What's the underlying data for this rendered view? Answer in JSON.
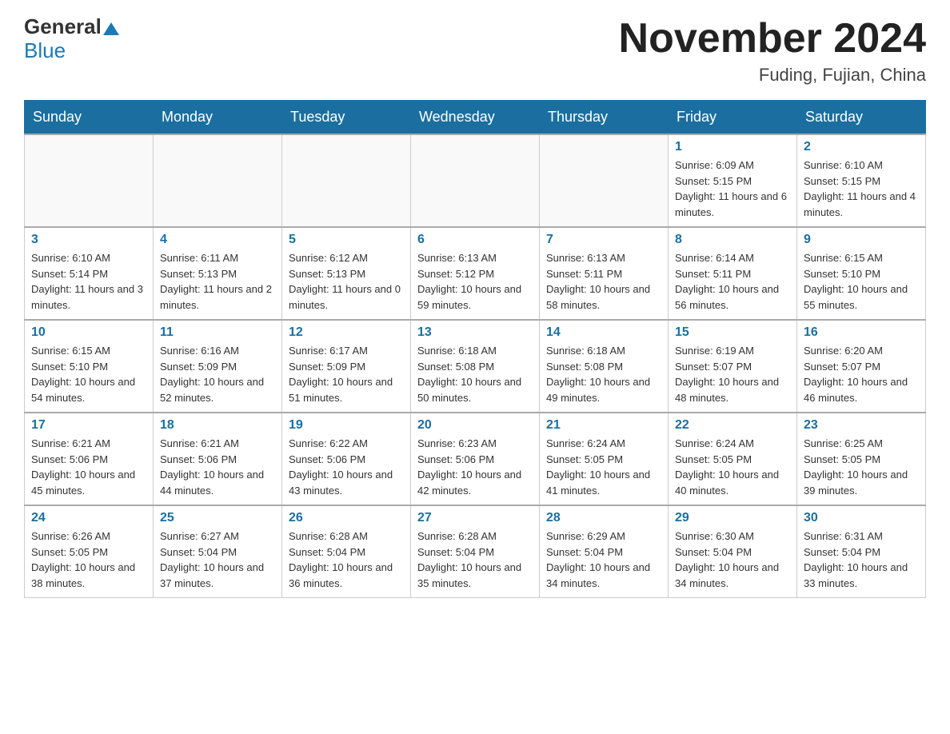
{
  "header": {
    "logo_general": "General",
    "logo_blue": "Blue",
    "month_title": "November 2024",
    "location": "Fuding, Fujian, China"
  },
  "days_of_week": [
    "Sunday",
    "Monday",
    "Tuesday",
    "Wednesday",
    "Thursday",
    "Friday",
    "Saturday"
  ],
  "weeks": [
    {
      "days": [
        {
          "number": "",
          "info": ""
        },
        {
          "number": "",
          "info": ""
        },
        {
          "number": "",
          "info": ""
        },
        {
          "number": "",
          "info": ""
        },
        {
          "number": "",
          "info": ""
        },
        {
          "number": "1",
          "info": "Sunrise: 6:09 AM\nSunset: 5:15 PM\nDaylight: 11 hours and 6 minutes."
        },
        {
          "number": "2",
          "info": "Sunrise: 6:10 AM\nSunset: 5:15 PM\nDaylight: 11 hours and 4 minutes."
        }
      ]
    },
    {
      "days": [
        {
          "number": "3",
          "info": "Sunrise: 6:10 AM\nSunset: 5:14 PM\nDaylight: 11 hours and 3 minutes."
        },
        {
          "number": "4",
          "info": "Sunrise: 6:11 AM\nSunset: 5:13 PM\nDaylight: 11 hours and 2 minutes."
        },
        {
          "number": "5",
          "info": "Sunrise: 6:12 AM\nSunset: 5:13 PM\nDaylight: 11 hours and 0 minutes."
        },
        {
          "number": "6",
          "info": "Sunrise: 6:13 AM\nSunset: 5:12 PM\nDaylight: 10 hours and 59 minutes."
        },
        {
          "number": "7",
          "info": "Sunrise: 6:13 AM\nSunset: 5:11 PM\nDaylight: 10 hours and 58 minutes."
        },
        {
          "number": "8",
          "info": "Sunrise: 6:14 AM\nSunset: 5:11 PM\nDaylight: 10 hours and 56 minutes."
        },
        {
          "number": "9",
          "info": "Sunrise: 6:15 AM\nSunset: 5:10 PM\nDaylight: 10 hours and 55 minutes."
        }
      ]
    },
    {
      "days": [
        {
          "number": "10",
          "info": "Sunrise: 6:15 AM\nSunset: 5:10 PM\nDaylight: 10 hours and 54 minutes."
        },
        {
          "number": "11",
          "info": "Sunrise: 6:16 AM\nSunset: 5:09 PM\nDaylight: 10 hours and 52 minutes."
        },
        {
          "number": "12",
          "info": "Sunrise: 6:17 AM\nSunset: 5:09 PM\nDaylight: 10 hours and 51 minutes."
        },
        {
          "number": "13",
          "info": "Sunrise: 6:18 AM\nSunset: 5:08 PM\nDaylight: 10 hours and 50 minutes."
        },
        {
          "number": "14",
          "info": "Sunrise: 6:18 AM\nSunset: 5:08 PM\nDaylight: 10 hours and 49 minutes."
        },
        {
          "number": "15",
          "info": "Sunrise: 6:19 AM\nSunset: 5:07 PM\nDaylight: 10 hours and 48 minutes."
        },
        {
          "number": "16",
          "info": "Sunrise: 6:20 AM\nSunset: 5:07 PM\nDaylight: 10 hours and 46 minutes."
        }
      ]
    },
    {
      "days": [
        {
          "number": "17",
          "info": "Sunrise: 6:21 AM\nSunset: 5:06 PM\nDaylight: 10 hours and 45 minutes."
        },
        {
          "number": "18",
          "info": "Sunrise: 6:21 AM\nSunset: 5:06 PM\nDaylight: 10 hours and 44 minutes."
        },
        {
          "number": "19",
          "info": "Sunrise: 6:22 AM\nSunset: 5:06 PM\nDaylight: 10 hours and 43 minutes."
        },
        {
          "number": "20",
          "info": "Sunrise: 6:23 AM\nSunset: 5:06 PM\nDaylight: 10 hours and 42 minutes."
        },
        {
          "number": "21",
          "info": "Sunrise: 6:24 AM\nSunset: 5:05 PM\nDaylight: 10 hours and 41 minutes."
        },
        {
          "number": "22",
          "info": "Sunrise: 6:24 AM\nSunset: 5:05 PM\nDaylight: 10 hours and 40 minutes."
        },
        {
          "number": "23",
          "info": "Sunrise: 6:25 AM\nSunset: 5:05 PM\nDaylight: 10 hours and 39 minutes."
        }
      ]
    },
    {
      "days": [
        {
          "number": "24",
          "info": "Sunrise: 6:26 AM\nSunset: 5:05 PM\nDaylight: 10 hours and 38 minutes."
        },
        {
          "number": "25",
          "info": "Sunrise: 6:27 AM\nSunset: 5:04 PM\nDaylight: 10 hours and 37 minutes."
        },
        {
          "number": "26",
          "info": "Sunrise: 6:28 AM\nSunset: 5:04 PM\nDaylight: 10 hours and 36 minutes."
        },
        {
          "number": "27",
          "info": "Sunrise: 6:28 AM\nSunset: 5:04 PM\nDaylight: 10 hours and 35 minutes."
        },
        {
          "number": "28",
          "info": "Sunrise: 6:29 AM\nSunset: 5:04 PM\nDaylight: 10 hours and 34 minutes."
        },
        {
          "number": "29",
          "info": "Sunrise: 6:30 AM\nSunset: 5:04 PM\nDaylight: 10 hours and 34 minutes."
        },
        {
          "number": "30",
          "info": "Sunrise: 6:31 AM\nSunset: 5:04 PM\nDaylight: 10 hours and 33 minutes."
        }
      ]
    }
  ]
}
